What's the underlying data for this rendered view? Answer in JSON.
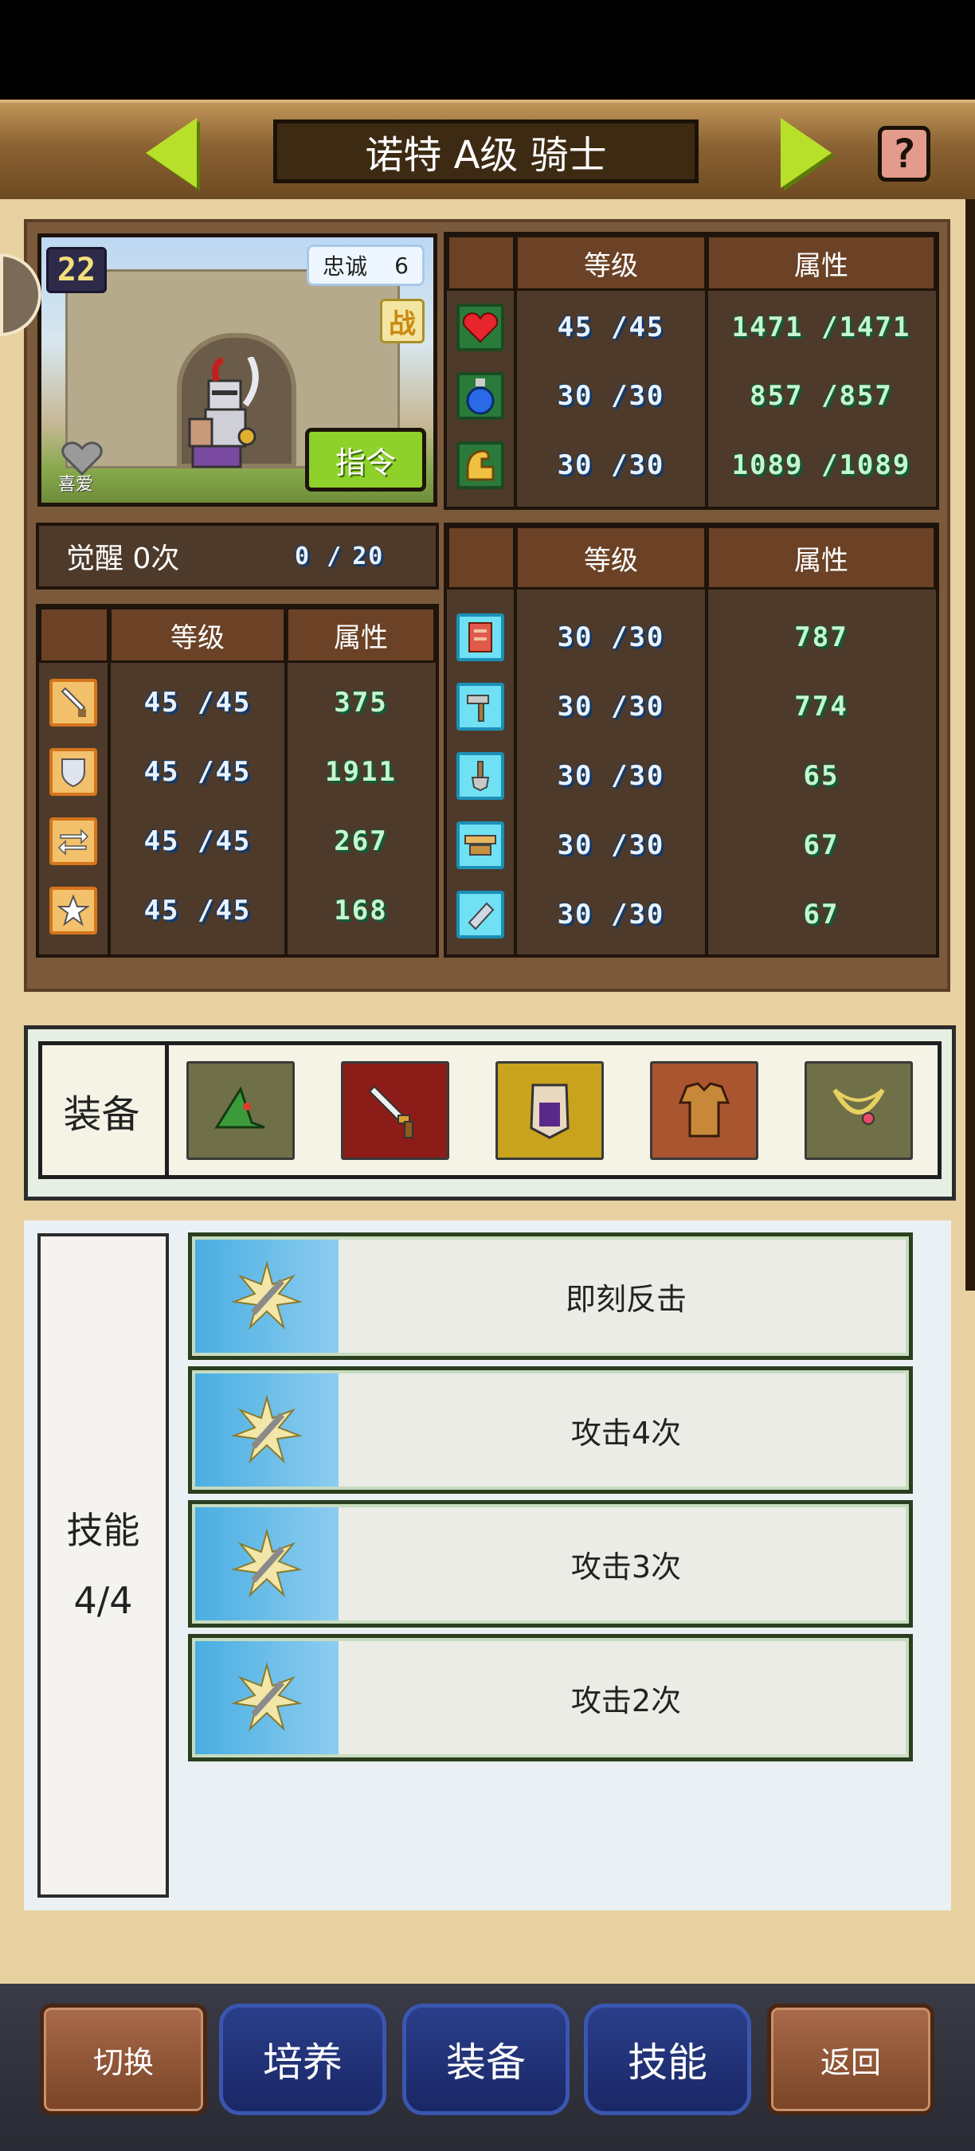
{
  "header": {
    "title": "诺特 A级 骑士",
    "help_label": "?"
  },
  "hero": {
    "level": "22",
    "loyalty_label": "忠诚",
    "loyalty_value": "6",
    "battle_badge": "战",
    "command_button": "指令",
    "like_label": "喜爱",
    "awaken_label": "觉醒 0次",
    "awaken_progress": "0 /",
    "awaken_max": "20"
  },
  "main_stats": {
    "headers": [
      "等级",
      "属性"
    ],
    "rows": [
      {
        "icon": "heart-icon",
        "level": "45 /45",
        "value": "1471 /1471"
      },
      {
        "icon": "potion-icon",
        "level": "30 /30",
        "value": "857 /857"
      },
      {
        "icon": "muscle-icon",
        "level": "30 /30",
        "value": "1089 /1089"
      }
    ]
  },
  "combat_stats": {
    "headers": [
      "等级",
      "属性"
    ],
    "rows": [
      {
        "icon": "sword-icon",
        "level": "45 /45",
        "value": "375"
      },
      {
        "icon": "shield-icon",
        "level": "45 /45",
        "value": "1911"
      },
      {
        "icon": "speed-arrows-icon",
        "level": "45 /45",
        "value": "267"
      },
      {
        "icon": "star-icon",
        "level": "45 /45",
        "value": "168"
      }
    ]
  },
  "work_stats": {
    "headers": [
      "等级",
      "属性"
    ],
    "rows": [
      {
        "icon": "book-icon",
        "level": "30 /30",
        "value": "787"
      },
      {
        "icon": "hammer-icon",
        "level": "30 /30",
        "value": "774"
      },
      {
        "icon": "shovel-icon",
        "level": "30 /30",
        "value": "65"
      },
      {
        "icon": "tray-icon",
        "level": "30 /30",
        "value": "67"
      },
      {
        "icon": "whetstone-icon",
        "level": "30 /30",
        "value": "67"
      }
    ]
  },
  "equipment": {
    "label": "装备",
    "slots": [
      {
        "icon": "green-hat-icon",
        "bg": "#6f7048"
      },
      {
        "icon": "dagger-icon",
        "bg": "#8c1c18"
      },
      {
        "icon": "cape-icon",
        "bg": "#c9a21e"
      },
      {
        "icon": "leather-armor-icon",
        "bg": "#a85530"
      },
      {
        "icon": "necklace-icon",
        "bg": "#6f7048"
      }
    ]
  },
  "skills": {
    "label": "技能",
    "count": "4/4",
    "items": [
      "即刻反击",
      "攻击4次",
      "攻击3次",
      "攻击2次"
    ]
  },
  "bottom_nav": [
    "切换",
    "培养",
    "装备",
    "技能",
    "返回"
  ]
}
